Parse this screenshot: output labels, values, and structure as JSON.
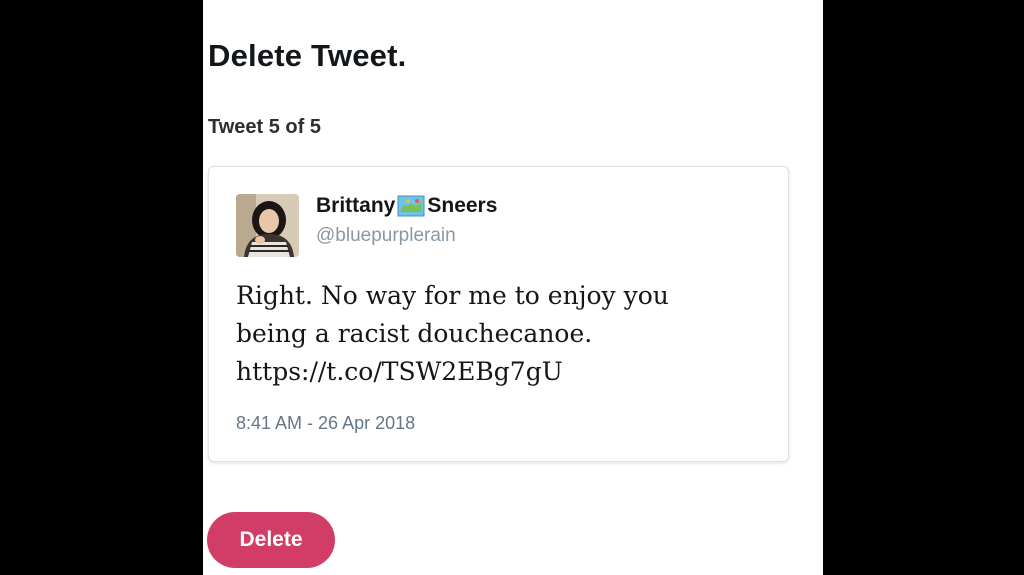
{
  "header": {
    "title": "Delete Tweet.",
    "counter": "Tweet 5 of 5"
  },
  "tweet": {
    "author": {
      "name_part1": "Brittany",
      "name_emoji": "map-emoji",
      "name_part2": "Sneers",
      "handle": "@bluepurplerain"
    },
    "text_lines": [
      "Right. No way for me to enjoy you",
      "being a racist douchecanoe.",
      "https://t.co/TSW2EBg7gU"
    ],
    "timestamp": "8:41 AM - 26 Apr 2018"
  },
  "actions": {
    "delete_label": "Delete"
  },
  "colors": {
    "delete_button": "#d13d66",
    "handle": "#8899a6",
    "timestamp": "#657786",
    "text": "#14171a",
    "page_background": "#ffffff",
    "letterbox": "#000000"
  }
}
